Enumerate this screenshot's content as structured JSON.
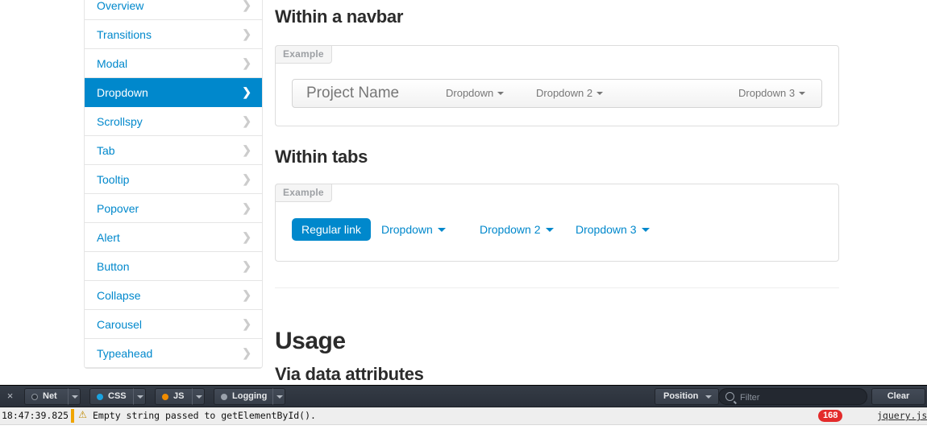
{
  "sidebar": {
    "items": [
      {
        "label": "Overview",
        "active": false
      },
      {
        "label": "Transitions",
        "active": false
      },
      {
        "label": "Modal",
        "active": false
      },
      {
        "label": "Dropdown",
        "active": true
      },
      {
        "label": "Scrollspy",
        "active": false
      },
      {
        "label": "Tab",
        "active": false
      },
      {
        "label": "Tooltip",
        "active": false
      },
      {
        "label": "Popover",
        "active": false
      },
      {
        "label": "Alert",
        "active": false
      },
      {
        "label": "Button",
        "active": false
      },
      {
        "label": "Collapse",
        "active": false
      },
      {
        "label": "Carousel",
        "active": false
      },
      {
        "label": "Typeahead",
        "active": false
      }
    ],
    "chevron": "❯",
    "active_color": "#0088cc",
    "link_color": "#0088cc"
  },
  "content": {
    "heading_navbar": "Within a navbar",
    "heading_tabs": "Within tabs",
    "heading_usage": "Usage",
    "heading_via_data": "Via data attributes",
    "example_label": "Example",
    "navbar_example": {
      "brand": "Project Name",
      "links": [
        {
          "label": "Dropdown",
          "caret": true
        },
        {
          "label": "Dropdown 2",
          "caret": true
        },
        {
          "label": "Dropdown 3",
          "caret": true
        }
      ]
    },
    "tabs_example": {
      "pills": [
        {
          "label": "Regular link",
          "active": true,
          "caret": false
        },
        {
          "label": "Dropdown",
          "active": false,
          "caret": true
        },
        {
          "label": "Dropdown 2",
          "active": false,
          "caret": true
        },
        {
          "label": "Dropdown 3",
          "active": false,
          "caret": true
        }
      ]
    }
  },
  "console": {
    "close_icon": "×",
    "panels": [
      {
        "label": "Net",
        "dot_color": "#2b313a",
        "dot_border": "#8f969f"
      },
      {
        "label": "CSS",
        "dot_color": "#1aa3e0",
        "dot_border": "#1aa3e0"
      },
      {
        "label": "JS",
        "dot_color": "#f08c00",
        "dot_border": "#f08c00"
      },
      {
        "label": "Logging",
        "dot_color": "#9aa1ab",
        "dot_border": "#9aa1ab"
      }
    ],
    "position_label": "Position",
    "filter_placeholder": "Filter",
    "filter_value": "",
    "clear_label": "Clear",
    "log": {
      "timestamp": "18:47:39.825",
      "warning_icon": "⚠",
      "message": "Empty string passed to getElementById().",
      "count": "168",
      "source": "jquery.js:",
      "count_color": "#e32b2b"
    }
  }
}
